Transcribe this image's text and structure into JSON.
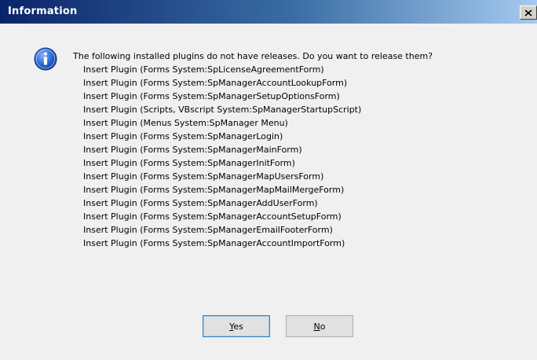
{
  "window": {
    "title": "Information",
    "close_icon": "close-icon"
  },
  "content": {
    "icon": "info-icon",
    "message": "The following installed plugins do not have releases.  Do you want to release them?",
    "plugins": [
      "Insert Plugin (Forms System:SpLicenseAgreementForm)",
      "Insert Plugin (Forms System:SpManagerAccountLookupForm)",
      "Insert Plugin (Forms System:SpManagerSetupOptionsForm)",
      "Insert Plugin (Scripts, VBscript System:SpManagerStartupScript)",
      "Insert Plugin (Menus System:SpManager Menu)",
      "Insert Plugin (Forms System:SpManagerLogin)",
      "Insert Plugin (Forms System:SpManagerMainForm)",
      "Insert Plugin (Forms System:SpManagerInitForm)",
      "Insert Plugin (Forms System:SpManagerMapUsersForm)",
      "Insert Plugin (Forms System:SpManagerMapMailMergeForm)",
      "Insert Plugin (Forms System:SpManagerAddUserForm)",
      "Insert Plugin (Forms System:SpManagerAccountSetupForm)",
      "Insert Plugin (Forms System:SpManagerEmailFooterForm)",
      "Insert Plugin (Forms System:SpManagerAccountImportForm)"
    ]
  },
  "buttons": {
    "yes_label": "Yes",
    "no_label": "No"
  },
  "colors": {
    "titlebar_start": "#0a246a",
    "titlebar_end": "#a6caf0",
    "dialog_background": "#f0f0f0",
    "icon_blue": "#1c5bc8"
  }
}
